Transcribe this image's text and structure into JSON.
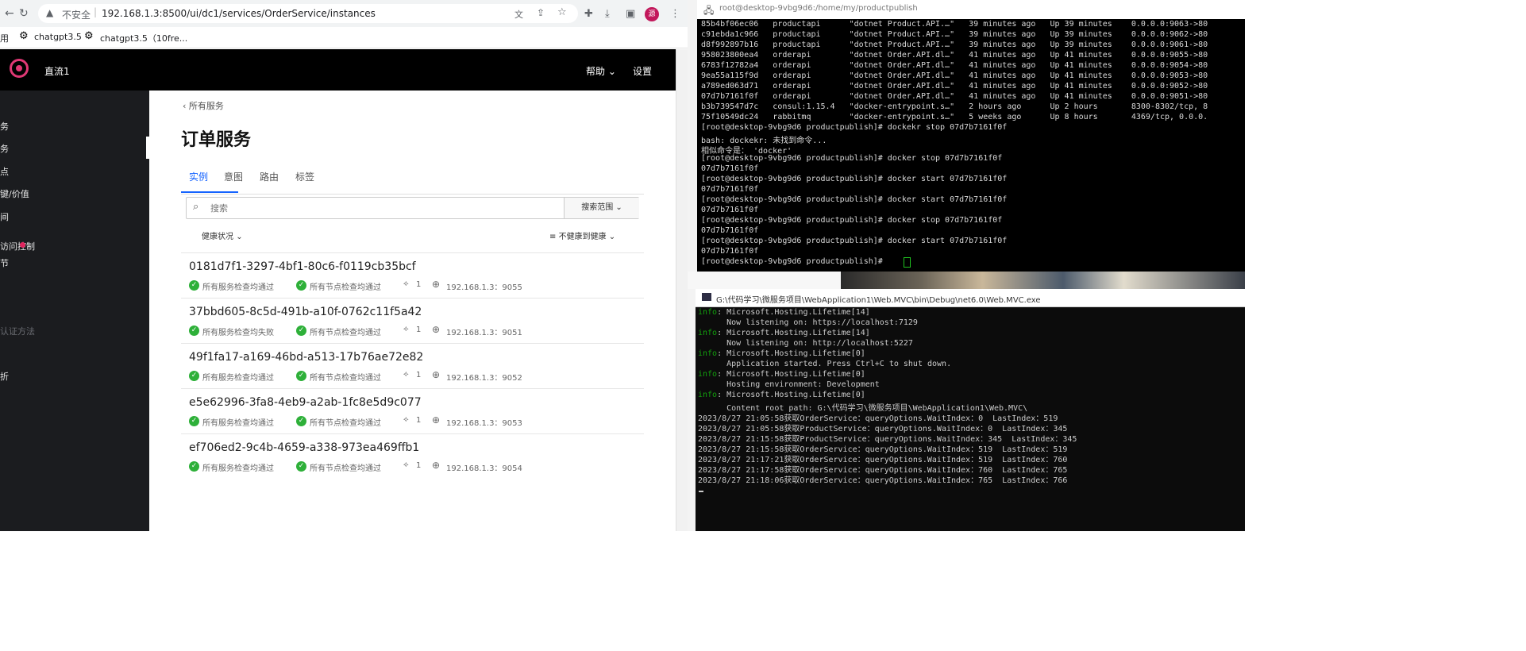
{
  "browser": {
    "insecure_label": "不安全",
    "url": "192.168.1.3:8500/ui/dc1/services/OrderService/instances",
    "profile_initial": "源",
    "bookmarks": [
      "用",
      "chatgpt3.5",
      "chatgpt3.5（10fre..."
    ]
  },
  "consul": {
    "datacenter": "直流1",
    "help_label": "帮助",
    "settings_label": "设置",
    "sidebar_items": [
      "务",
      "务",
      "点",
      "键/价值",
      "间",
      "访问控制",
      "节",
      "",
      "",
      "认证方法",
      "",
      "折"
    ],
    "back_link": "所有服务",
    "page_title": "订单服务",
    "tabs": [
      "实例",
      "意图",
      "路由",
      "标签"
    ],
    "search_placeholder": "搜索",
    "search_scope_label": "搜索范围",
    "health_filter_label": "健康状况",
    "sort_label": "不健康到健康",
    "instances": [
      {
        "id": "0181d7f1-3297-4bf1-80c6-f0119cb35bcf",
        "service_check": "所有服务检查均通过",
        "node_check": "所有节点检查均通过",
        "tags": "1",
        "address": "192.168.1.3：9055"
      },
      {
        "id": "37bbd605-8c5d-491b-a10f-0762c11f5a42",
        "service_check": "所有服务检查均失败",
        "node_check": "所有节点检查均通过",
        "tags": "1",
        "address": "192.168.1.3：9051"
      },
      {
        "id": "49f1fa17-a169-46bd-a513-17b76ae72e82",
        "service_check": "所有服务检查均通过",
        "node_check": "所有节点检查均通过",
        "tags": "1",
        "address": "192.168.1.3：9052"
      },
      {
        "id": "e5e62996-3fa8-4eb9-a2ab-1fc8e5d9c077",
        "service_check": "所有服务检查均通过",
        "node_check": "所有节点检查均通过",
        "tags": "1",
        "address": "192.168.1.3：9053"
      },
      {
        "id": "ef706ed2-9c4b-4659-a338-973ea469ffb1",
        "service_check": "所有服务检查均通过",
        "node_check": "所有节点检查均通过",
        "tags": "1",
        "address": "192.168.1.3：9054"
      }
    ],
    "check_color": "#2eb039"
  },
  "putty": {
    "title": "root@desktop-9vbg9d6:/home/my/productpublish",
    "lines": [
      "85b4bf06ec06   productapi      \"dotnet Product.API.…\"   39 minutes ago   Up 39 minutes    0.0.0.0:9063->80",
      "c91ebda1c966   productapi      \"dotnet Product.API.…\"   39 minutes ago   Up 39 minutes    0.0.0.0:9062->80",
      "d8f992897b16   productapi      \"dotnet Product.API.…\"   39 minutes ago   Up 39 minutes    0.0.0.0:9061->80",
      "958023800ea4   orderapi        \"dotnet Order.API.dl…\"   41 minutes ago   Up 41 minutes    0.0.0.0:9055->80",
      "6783f12782a4   orderapi        \"dotnet Order.API.dl…\"   41 minutes ago   Up 41 minutes    0.0.0.0:9054->80",
      "9ea55a115f9d   orderapi        \"dotnet Order.API.dl…\"   41 minutes ago   Up 41 minutes    0.0.0.0:9053->80",
      "a789ed063d71   orderapi        \"dotnet Order.API.dl…\"   41 minutes ago   Up 41 minutes    0.0.0.0:9052->80",
      "07d7b7161f0f   orderapi        \"dotnet Order.API.dl…\"   41 minutes ago   Up 41 minutes    0.0.0.0:9051->80",
      "b3b739547d7c   consul:1.15.4   \"docker-entrypoint.s…\"   2 hours ago      Up 2 hours       8300-8302/tcp, 8",
      "75f10549dc24   rabbitmq        \"docker-entrypoint.s…\"   5 weeks ago      Up 8 hours       4369/tcp, 0.0.0.",
      "[root@desktop-9vbg9d6 productpublish]# dockekr stop 07d7b7161f0f",
      "bash: dockekr: 未找到命令...",
      "相似命令是： 'docker'",
      "[root@desktop-9vbg9d6 productpublish]# docker stop 07d7b7161f0f",
      "07d7b7161f0f",
      "[root@desktop-9vbg9d6 productpublish]# docker start 07d7b7161f0f",
      "07d7b7161f0f",
      "[root@desktop-9vbg9d6 productpublish]# docker start 07d7b7161f0f",
      "07d7b7161f0f",
      "[root@desktop-9vbg9d6 productpublish]# docker stop 07d7b7161f0f",
      "07d7b7161f0f",
      "[root@desktop-9vbg9d6 productpublish]# docker start 07d7b7161f0f",
      "07d7b7161f0f",
      "[root@desktop-9vbg9d6 productpublish]# "
    ]
  },
  "cmd": {
    "title": "G:\\代码学习\\微服务项目\\WebApplication1\\Web.MVC\\bin\\Debug\\net6.0\\Web.MVC.exe",
    "lines": [
      {
        "prefix": "info",
        "text": ": Microsoft.Hosting.Lifetime[14]"
      },
      {
        "prefix": "",
        "text": "      Now listening on: https://localhost:7129"
      },
      {
        "prefix": "info",
        "text": ": Microsoft.Hosting.Lifetime[14]"
      },
      {
        "prefix": "",
        "text": "      Now listening on: http://localhost:5227"
      },
      {
        "prefix": "info",
        "text": ": Microsoft.Hosting.Lifetime[0]"
      },
      {
        "prefix": "",
        "text": "      Application started. Press Ctrl+C to shut down."
      },
      {
        "prefix": "info",
        "text": ": Microsoft.Hosting.Lifetime[0]"
      },
      {
        "prefix": "",
        "text": "      Hosting environment: Development"
      },
      {
        "prefix": "info",
        "text": ": Microsoft.Hosting.Lifetime[0]"
      },
      {
        "prefix": "",
        "text": "      Content root path: G:\\代码学习\\微服务项目\\WebApplication1\\Web.MVC\\"
      },
      {
        "prefix": "",
        "text": "2023/8/27 21:05:58获取OrderService：queryOptions.WaitIndex：0  LastIndex：519"
      },
      {
        "prefix": "",
        "text": "2023/8/27 21:05:58获取ProductService：queryOptions.WaitIndex：0  LastIndex：345"
      },
      {
        "prefix": "",
        "text": "2023/8/27 21:15:58获取ProductService：queryOptions.WaitIndex：345  LastIndex：345"
      },
      {
        "prefix": "",
        "text": "2023/8/27 21:15:58获取OrderService：queryOptions.WaitIndex：519  LastIndex：519"
      },
      {
        "prefix": "",
        "text": "2023/8/27 21:17:21获取OrderService：queryOptions.WaitIndex：519  LastIndex：760"
      },
      {
        "prefix": "",
        "text": "2023/8/27 21:17:58获取OrderService：queryOptions.WaitIndex：760  LastIndex：765"
      },
      {
        "prefix": "",
        "text": "2023/8/27 21:18:06获取OrderService：queryOptions.WaitIndex：765  LastIndex：766"
      }
    ]
  }
}
